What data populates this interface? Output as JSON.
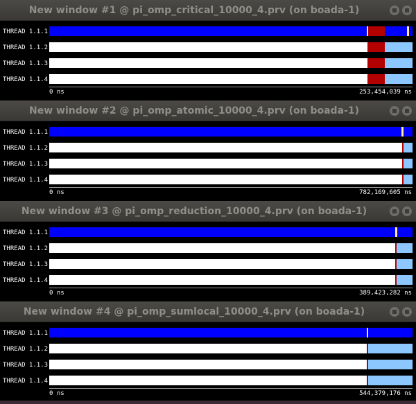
{
  "colors": {
    "running": "#0000ff",
    "critical": "#b30000",
    "idle_sync": "#8cc8ff",
    "marker": "#ffeb99",
    "background": "#ffffff"
  },
  "windows": [
    {
      "title": "New window #1 @ pi_omp_critical_10000_4.prv (on boada-1)",
      "axis_start": "0 ns",
      "axis_end": "253,454,039 ns",
      "threads": [
        {
          "label": "THREAD 1.1.1",
          "segments": [
            {
              "state": "running",
              "start": 0.0,
              "end": 0.874
            },
            {
              "state": "marker",
              "start": 0.874,
              "end": 0.878
            },
            {
              "state": "critical",
              "start": 0.878,
              "end": 0.924
            },
            {
              "state": "running",
              "start": 0.924,
              "end": 0.985
            },
            {
              "state": "marker",
              "start": 0.985,
              "end": 0.99
            },
            {
              "state": "running",
              "start": 0.99,
              "end": 1.0
            }
          ]
        },
        {
          "label": "THREAD 1.1.2",
          "segments": [
            {
              "state": "critical",
              "start": 0.876,
              "end": 0.924
            },
            {
              "state": "idle_sync",
              "start": 0.924,
              "end": 1.0
            }
          ]
        },
        {
          "label": "THREAD 1.1.3",
          "segments": [
            {
              "state": "critical",
              "start": 0.876,
              "end": 0.924
            },
            {
              "state": "idle_sync",
              "start": 0.924,
              "end": 1.0
            }
          ]
        },
        {
          "label": "THREAD 1.1.4",
          "segments": [
            {
              "state": "critical",
              "start": 0.876,
              "end": 0.924
            },
            {
              "state": "idle_sync",
              "start": 0.924,
              "end": 1.0
            }
          ]
        }
      ]
    },
    {
      "title": "New window #2 @ pi_omp_atomic_10000_4.prv (on boada-1)",
      "axis_start": "0 ns",
      "axis_end": "782,169,605 ns",
      "threads": [
        {
          "label": "THREAD 1.1.1",
          "segments": [
            {
              "state": "running",
              "start": 0.0,
              "end": 0.97
            },
            {
              "state": "marker",
              "start": 0.97,
              "end": 0.975
            },
            {
              "state": "running",
              "start": 0.975,
              "end": 1.0
            }
          ]
        },
        {
          "label": "THREAD 1.1.2",
          "segments": [
            {
              "state": "critical",
              "start": 0.972,
              "end": 0.975
            },
            {
              "state": "idle_sync",
              "start": 0.975,
              "end": 1.0
            }
          ]
        },
        {
          "label": "THREAD 1.1.3",
          "segments": [
            {
              "state": "critical",
              "start": 0.972,
              "end": 0.975
            },
            {
              "state": "idle_sync",
              "start": 0.975,
              "end": 1.0
            }
          ]
        },
        {
          "label": "THREAD 1.1.4",
          "segments": [
            {
              "state": "critical",
              "start": 0.972,
              "end": 0.975
            },
            {
              "state": "idle_sync",
              "start": 0.975,
              "end": 1.0
            }
          ]
        }
      ]
    },
    {
      "title": "New window #3 @ pi_omp_reduction_10000_4.prv (on boada-1)",
      "axis_start": "0 ns",
      "axis_end": "389,423,282 ns",
      "threads": [
        {
          "label": "THREAD 1.1.1",
          "segments": [
            {
              "state": "running",
              "start": 0.0,
              "end": 0.953
            },
            {
              "state": "marker",
              "start": 0.953,
              "end": 0.958
            },
            {
              "state": "running",
              "start": 0.958,
              "end": 1.0
            }
          ]
        },
        {
          "label": "THREAD 1.1.2",
          "segments": [
            {
              "state": "critical",
              "start": 0.953,
              "end": 0.956
            },
            {
              "state": "idle_sync",
              "start": 0.956,
              "end": 1.0
            }
          ]
        },
        {
          "label": "THREAD 1.1.3",
          "segments": [
            {
              "state": "critical",
              "start": 0.953,
              "end": 0.956
            },
            {
              "state": "idle_sync",
              "start": 0.956,
              "end": 1.0
            }
          ]
        },
        {
          "label": "THREAD 1.1.4",
          "segments": [
            {
              "state": "critical",
              "start": 0.953,
              "end": 0.956
            },
            {
              "state": "idle_sync",
              "start": 0.956,
              "end": 1.0
            }
          ]
        }
      ]
    },
    {
      "title": "New window #4 @ pi_omp_sumlocal_10000_4.prv (on boada-1)",
      "axis_start": "0 ns",
      "axis_end": "544,379,176 ns",
      "threads": [
        {
          "label": "THREAD 1.1.1",
          "segments": [
            {
              "state": "running",
              "start": 0.0,
              "end": 0.874
            },
            {
              "state": "marker",
              "start": 0.874,
              "end": 0.878
            },
            {
              "state": "running",
              "start": 0.878,
              "end": 1.0
            }
          ]
        },
        {
          "label": "THREAD 1.1.2",
          "segments": [
            {
              "state": "critical",
              "start": 0.874,
              "end": 0.877
            },
            {
              "state": "idle_sync",
              "start": 0.877,
              "end": 1.0
            }
          ]
        },
        {
          "label": "THREAD 1.1.3",
          "segments": [
            {
              "state": "critical",
              "start": 0.874,
              "end": 0.877
            },
            {
              "state": "idle_sync",
              "start": 0.877,
              "end": 1.0
            }
          ]
        },
        {
          "label": "THREAD 1.1.4",
          "segments": [
            {
              "state": "critical",
              "start": 0.874,
              "end": 0.877
            },
            {
              "state": "idle_sync",
              "start": 0.877,
              "end": 1.0
            }
          ]
        }
      ]
    }
  ]
}
